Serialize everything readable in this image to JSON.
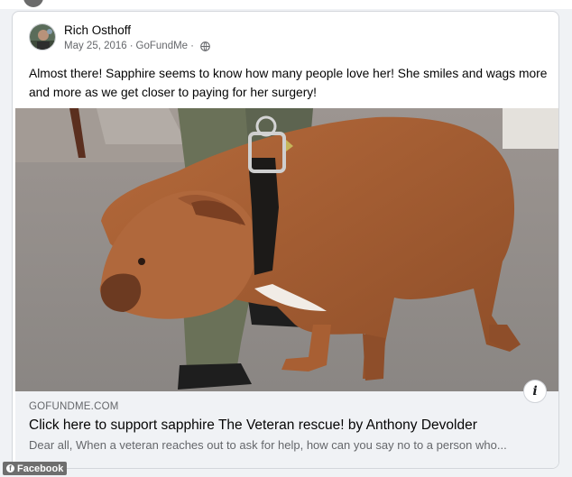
{
  "post": {
    "author": "Rich Osthoff",
    "date": "May 25, 2016",
    "separator": "·",
    "source": "GoFundMe",
    "privacy_icon": "globe-icon",
    "text": "Almost there! Sapphire seems to know how many people love her! She smiles and wags more and more as we get closer to paying for her surgery!"
  },
  "photo": {
    "subject": "brown dog with black collar",
    "icon": "post-photo"
  },
  "link_preview": {
    "domain": "GOFUNDME.COM",
    "title": "Click here to support sapphire The Veteran rescue! by Anthony Devolder",
    "description": "Dear all, When a veteran reaches out to ask for help, how can you say no to a person who..."
  },
  "info_button": {
    "label": "i",
    "icon": "info-icon"
  },
  "source_tag": {
    "label": "Facebook",
    "icon": "facebook-icon"
  },
  "colors": {
    "card_bg": "#ffffff",
    "page_bg": "#f0f2f5",
    "secondary_text": "#65676b",
    "primary_text": "#050505"
  }
}
